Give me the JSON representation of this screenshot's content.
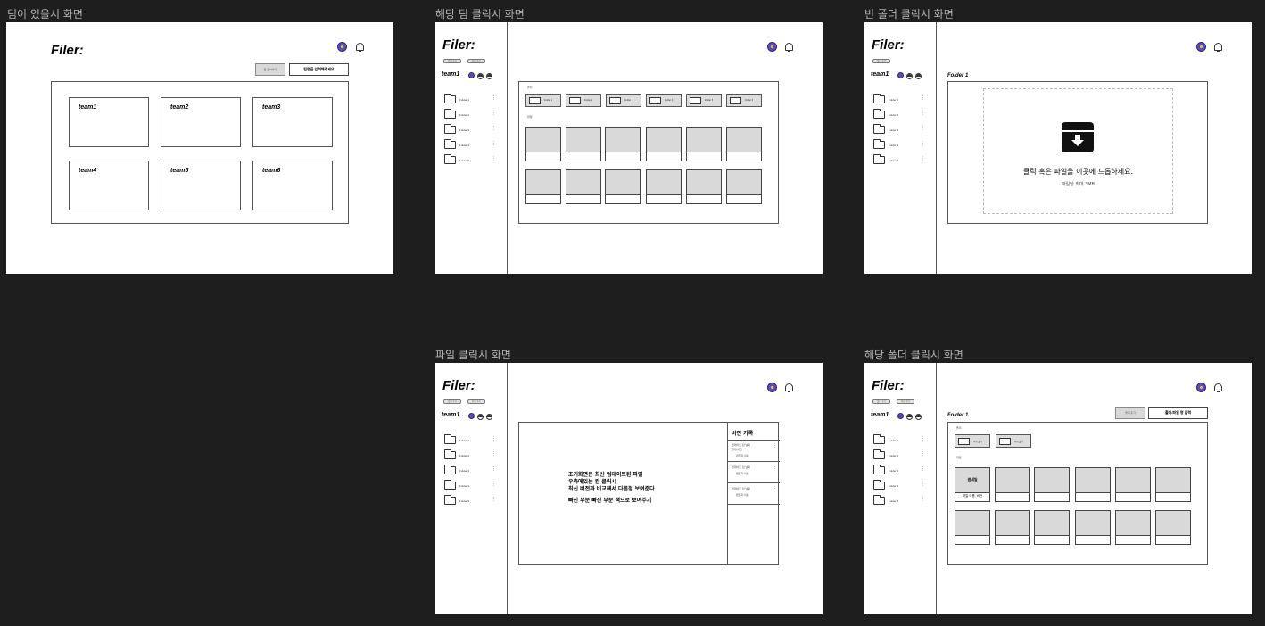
{
  "frames": {
    "teams": {
      "label": "팀이 있을시 화면"
    },
    "team_click": {
      "label": "해당 팀 클릭시 화면"
    },
    "empty_folder": {
      "label": "빈 폴더 클릭시 화면"
    },
    "file_click": {
      "label": "파일 클릭시 화면"
    },
    "folder_click": {
      "label": "해당 폴더 클릭시 화면"
    }
  },
  "app": {
    "logo": "Filer:",
    "team_name": "team1",
    "sidebar_pills": [
      "폴더 추가",
      "파일 추가"
    ],
    "sidebar_folders": [
      "Folder 1",
      "Folder 2",
      "Folder 3",
      "Folder 4",
      "Folder 5"
    ]
  },
  "teams_screen": {
    "small_button": "팀 참여하기",
    "input_button": "팀명을 입력해주세요",
    "teams": [
      "team1",
      "team2",
      "team3",
      "team4",
      "team5",
      "team6"
    ]
  },
  "team_screen": {
    "folders_label": "폴더",
    "files_label": "파일",
    "folders": [
      "Folder 1",
      "Folder 2",
      "Folder 3",
      "Folder 4",
      "Folder 5",
      "Folder 6"
    ]
  },
  "empty_screen": {
    "folder_title": "Folder 1",
    "drop_text": "클릭 혹은 파일을 이곳에 드롭하세요.",
    "limit_text": "파일당 최대 3MB"
  },
  "file_screen": {
    "note_lines": [
      "초기화면은 최신 업데이트된 파일",
      "우측에있는 칸 클릭시",
      "최신 버전과 비교해서 다른점 보여준다"
    ],
    "note_extra": "빠진 부분 빠진 부분 색으로 보여주기",
    "version_title": "버전 기록",
    "versions": [
      {
        "line1": "업데이트 된 날짜",
        "line2": "현재 버전",
        "user": "편집자 이름"
      },
      {
        "line1": "업데이트 된 날짜",
        "line2": "",
        "user": "편집자 이름"
      },
      {
        "line1": "업데이트 된 날짜",
        "line2": "",
        "user": "편집자 이름"
      }
    ]
  },
  "folder_screen": {
    "folder_title": "Folder 1",
    "small_button": "폴더 추가",
    "action_button": "폴더/파일 명 입력",
    "folders_label": "폴더",
    "files_label": "파일",
    "folder_chips": [
      "하위 폴더",
      "하위 폴더"
    ],
    "file_preview": "썸네일",
    "file_name": "파일 이름, 버전"
  }
}
